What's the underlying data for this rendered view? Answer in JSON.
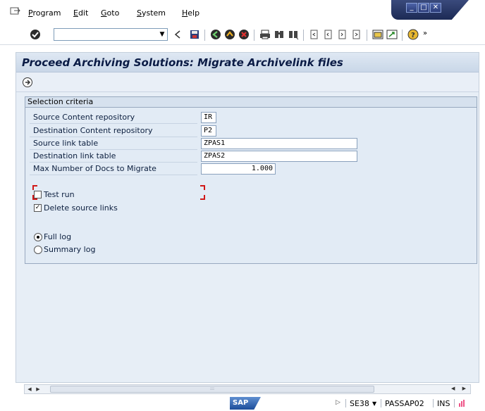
{
  "menubar": {
    "items": [
      "Program",
      "Edit",
      "Goto",
      "System",
      "Help"
    ]
  },
  "toolbar": {
    "command_value": "",
    "icons": [
      "enter-icon",
      "back-icon",
      "save-icon",
      "green-back-icon",
      "exit-icon",
      "cancel-icon",
      "print-icon",
      "find-icon",
      "find-next-icon",
      "first-page-icon",
      "prev-page-icon",
      "next-page-icon",
      "last-page-icon",
      "new-session-icon",
      "shortcut-icon",
      "help-icon"
    ]
  },
  "screen": {
    "title": "Proceed Archiving Solutions: Migrate Archivelink files"
  },
  "selection": {
    "title": "Selection criteria",
    "fields": [
      {
        "label": "Source Content repository",
        "value": "IR"
      },
      {
        "label": "Destination Content repository",
        "value": "P2"
      },
      {
        "label": "Source link table",
        "value": "ZPAS1"
      },
      {
        "label": "Destination link table",
        "value": "ZPAS2"
      },
      {
        "label": "Max Number of Docs to Migrate",
        "value": "1.000"
      }
    ],
    "checkboxes": [
      {
        "label": "Test run",
        "checked": false
      },
      {
        "label": "Delete source links",
        "checked": true
      }
    ],
    "radios": [
      {
        "label": "Full log",
        "selected": true
      },
      {
        "label": "Summary log",
        "selected": false
      }
    ]
  },
  "statusbar": {
    "logo": "SAP",
    "transaction": "SE38",
    "server": "PASSAP02",
    "mode": "INS"
  },
  "colors": {
    "title_text": "#0a1b45",
    "frame_bg": "#e7eef6",
    "group_border": "#98a9bf",
    "required_marker": "#d01818"
  }
}
